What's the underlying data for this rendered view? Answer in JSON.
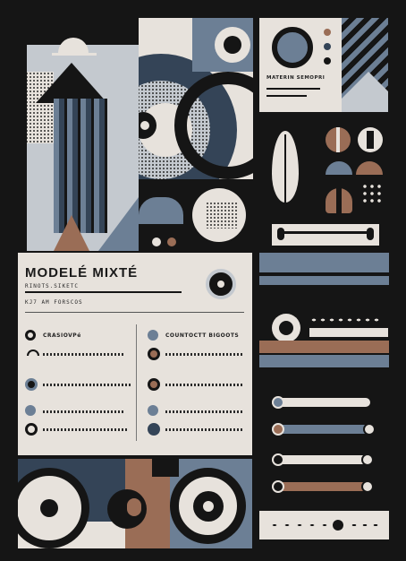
{
  "colors": {
    "black": "#151515",
    "cream": "#e7e2dc",
    "slate": "#6c7f95",
    "navy": "#344457",
    "brown": "#9a6d56"
  },
  "poster": {
    "material_label": "MATERIN SEMOPRI",
    "title": "MODELÉ MIXTÉ",
    "subtitle": "RINOTS.SIKETC",
    "caption": "KJ7 AM FORSCOS",
    "items": {
      "item1": "CRASIOVPé",
      "item2": "COUNTOCTT BIGOOTS"
    }
  },
  "sliders": [
    {
      "name": "slider-1",
      "fill": 0.8,
      "color": "#e7e2dc"
    },
    {
      "name": "slider-2",
      "fill": 0.85,
      "color": "#6c7f95"
    },
    {
      "name": "slider-3",
      "fill": 0.85,
      "color": "#e7e2dc"
    },
    {
      "name": "slider-4",
      "fill": 0.8,
      "color": "#9a6d56"
    }
  ],
  "icons": {
    "sun": "sun-icon",
    "feather": "feather-icon",
    "disc": "disc-icon",
    "dots": "dot-grid-icon"
  }
}
